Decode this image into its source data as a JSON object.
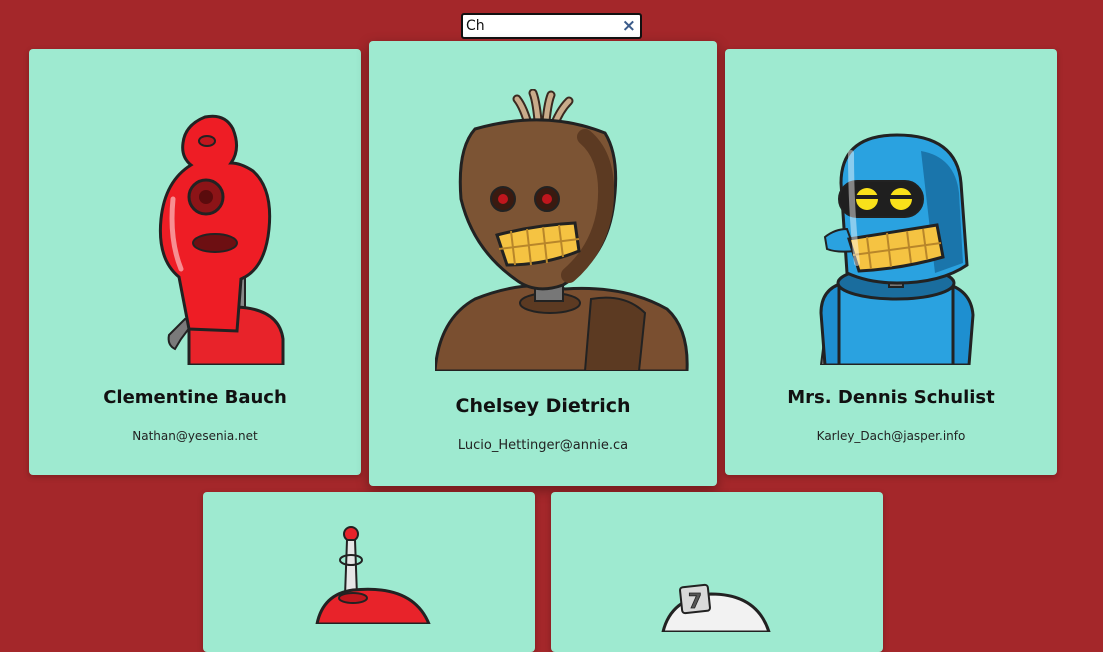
{
  "search": {
    "value": "Ch",
    "clear_symbol": "×"
  },
  "cards": [
    {
      "name": "Clementine Bauch",
      "email": "Nathan@yesenia.net",
      "avatar_icon": "red-robot-icon"
    },
    {
      "name": "Chelsey Dietrich",
      "email": "Lucio_Hettinger@annie.ca",
      "avatar_icon": "brown-robot-icon"
    },
    {
      "name": "Mrs. Dennis Schulist",
      "email": "Karley_Dach@jasper.info",
      "avatar_icon": "blue-robot-icon"
    },
    {
      "name": "",
      "email": "",
      "avatar_icon": "red-antenna-robot-icon"
    },
    {
      "name": "",
      "email": "",
      "avatar_icon": "white-robot-icon"
    }
  ],
  "colors": {
    "background": "#a4272a",
    "card": "#9eead0"
  }
}
